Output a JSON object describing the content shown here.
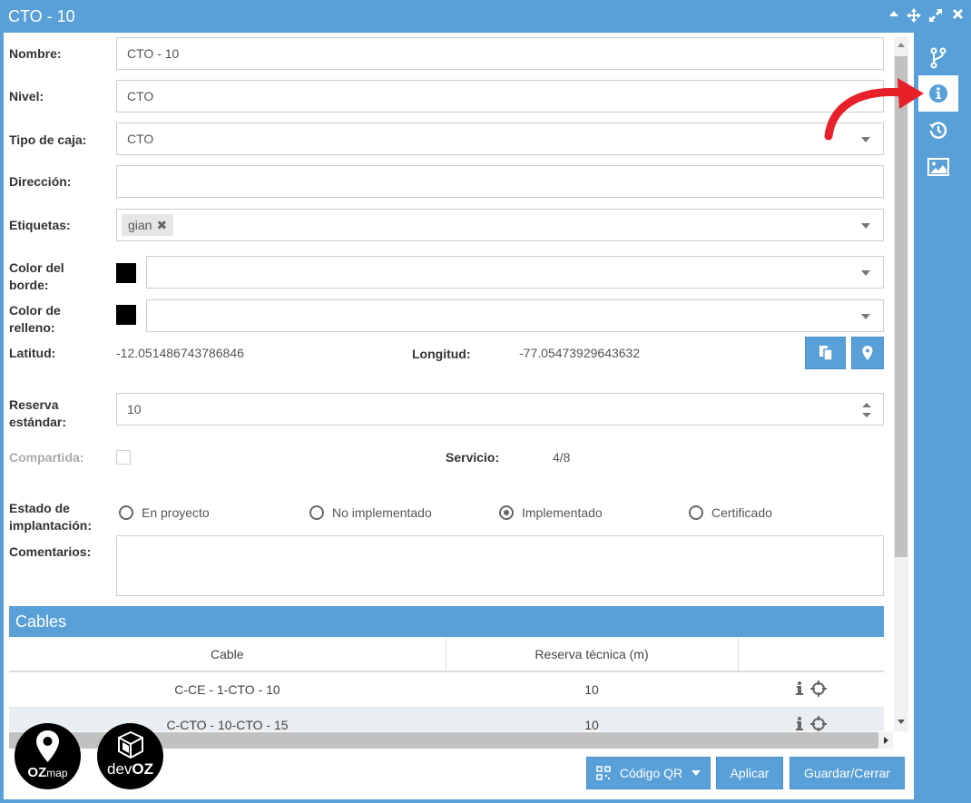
{
  "window": {
    "title": "CTO - 10"
  },
  "form": {
    "nombre": {
      "label": "Nombre:",
      "value": "CTO - 10"
    },
    "nivel": {
      "label": "Nivel:",
      "value": "CTO"
    },
    "tipo_caja": {
      "label": "Tipo de caja:",
      "value": "CTO"
    },
    "direccion": {
      "label": "Dirección:",
      "value": ""
    },
    "etiquetas": {
      "label": "Etiquetas:",
      "tags": [
        "gian"
      ],
      "remove_glyph": "✖"
    },
    "color_borde": {
      "label_line1": "Color del",
      "label_line2": "borde:",
      "swatch": "#000000",
      "value": ""
    },
    "color_relleno": {
      "label_line1": "Color de",
      "label_line2": "relleno:",
      "swatch": "#000000",
      "value": ""
    },
    "latitud": {
      "label": "Latitud:",
      "value": "-12.051486743786846"
    },
    "longitud": {
      "label": "Longitud:",
      "value": "-77.05473929643632"
    },
    "reserva": {
      "label_line1": "Reserva",
      "label_line2": "estándar:",
      "value": "10"
    },
    "compartida": {
      "label": "Compartida:",
      "checked": false
    },
    "servicio": {
      "label": "Servicio:",
      "value": "4/8"
    },
    "estado": {
      "label_line1": "Estado de",
      "label_line2": "implantación:",
      "options": [
        "En proyecto",
        "No implementado",
        "Implementado",
        "Certificado"
      ],
      "selected": "Implementado"
    },
    "comentarios": {
      "label": "Comentarios:",
      "value": ""
    }
  },
  "cables": {
    "title": "Cables",
    "columns": [
      "Cable",
      "Reserva técnica (m)",
      ""
    ],
    "rows": [
      {
        "cable": "C-CE - 1-CTO - 10",
        "reserva": "10"
      },
      {
        "cable": "C-CTO - 10-CTO - 15",
        "reserva": "10"
      }
    ]
  },
  "footer": {
    "qr_label": "Código QR",
    "apply_label": "Aplicar",
    "save_label": "Guardar/Cerrar"
  },
  "logos": {
    "ozmap_prefix": "OZ",
    "ozmap_suffix": "map",
    "devoz_prefix": "dev",
    "devoz_suffix": "OZ"
  },
  "sidebar": {
    "icons": [
      "branch-icon",
      "info-icon",
      "history-icon",
      "image-icon"
    ],
    "active": "info-icon"
  },
  "colors": {
    "accent": "#5aa0d8",
    "annotation_arrow": "#e8202a"
  }
}
